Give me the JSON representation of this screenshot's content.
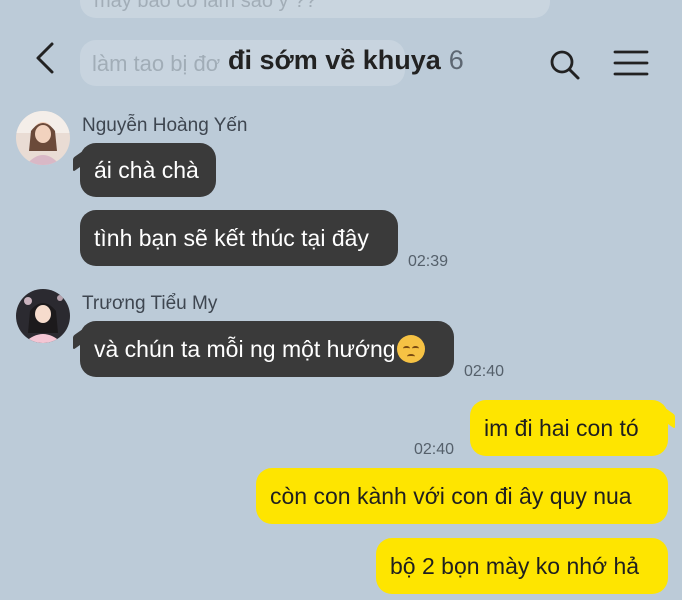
{
  "header": {
    "title": "đi sớm về khuya",
    "member_count": "6",
    "back_icon": "back-chevron-icon",
    "search_icon": "search-icon",
    "menu_icon": "hamburger-menu-icon"
  },
  "background_hint": {
    "top_text": "mày bảo có làm sao ý ??",
    "mid_text": "làm tao bị đơ"
  },
  "messages": {
    "m1": {
      "sender": "Nguyễn Hoàng Yến",
      "text": "ái chà chà"
    },
    "m2": {
      "text": "tình bạn sẽ kết thúc tại đây",
      "time": "02:39"
    },
    "m3": {
      "sender": "Trương Tiểu My",
      "text": "và chún ta mỗi ng một hướng",
      "emoji": "pensive-face-emoji",
      "time": "02:40"
    },
    "m4": {
      "text": "im đi hai con tó",
      "time": "02:40"
    },
    "m5": {
      "text": "còn con kành với con đi ây quy nua"
    },
    "m6": {
      "text": "bộ 2 bọn mày ko nhớ hả"
    }
  },
  "colors": {
    "background": "#bccbd8",
    "incoming_bubble": "#3a3a3a",
    "outgoing_bubble": "#fee500"
  }
}
